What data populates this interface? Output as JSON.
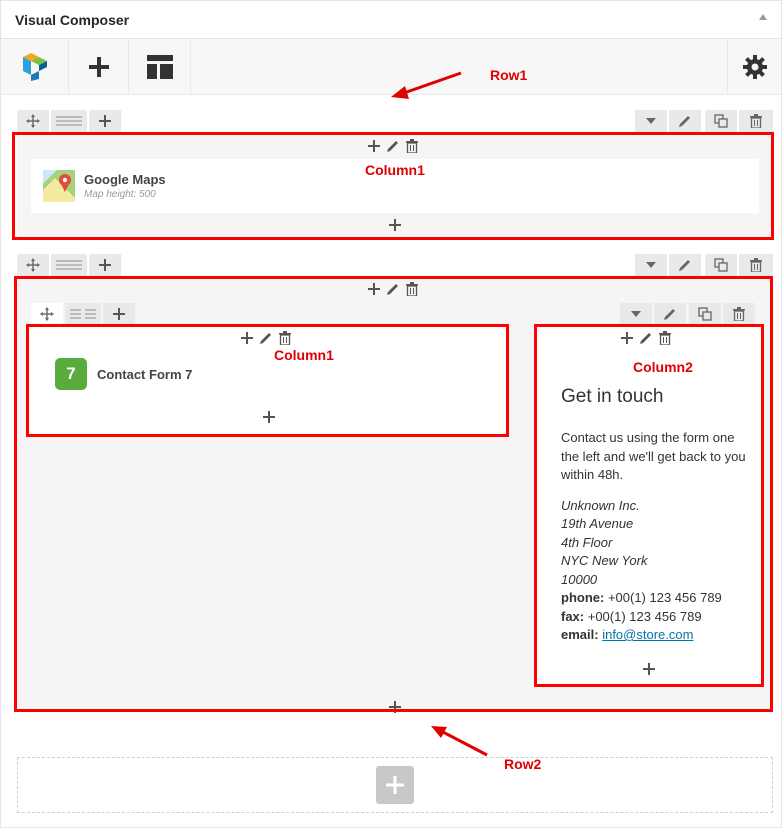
{
  "panel": {
    "title": "Visual Composer"
  },
  "annotations": {
    "row1": "Row1",
    "row2": "Row2",
    "column1": "Column1",
    "column2": "Column2"
  },
  "row1": {
    "element": {
      "title": "Google Maps",
      "subtitle": "Map height: 500"
    }
  },
  "row2": {
    "column1": {
      "element_title": "Contact Form 7",
      "badge": "7"
    },
    "column2": {
      "heading": "Get in touch",
      "intro": "Contact us using the form one the left and we'll get back to you within 48h.",
      "address": [
        "Unknown Inc.",
        "19th Avenue",
        "4th Floor",
        "NYC New York",
        "10000"
      ],
      "phone_label": "phone:",
      "phone_value": " +00(1) 123 456 789",
      "fax_label": "fax:",
      "fax_value": " +00(1) 123 456 789",
      "email_label": "email:",
      "email_value": "info@store.com"
    }
  },
  "colors": {
    "accent_red": "#ff0000",
    "badge_green": "#5aab3e",
    "link": "#0073aa"
  },
  "icons": [
    "vc-logo-icon",
    "plus-icon",
    "templates-icon",
    "gear-icon",
    "move-icon",
    "layout-icon",
    "chevron-down-icon",
    "pencil-icon",
    "clone-icon",
    "trash-icon",
    "maps-icon"
  ]
}
